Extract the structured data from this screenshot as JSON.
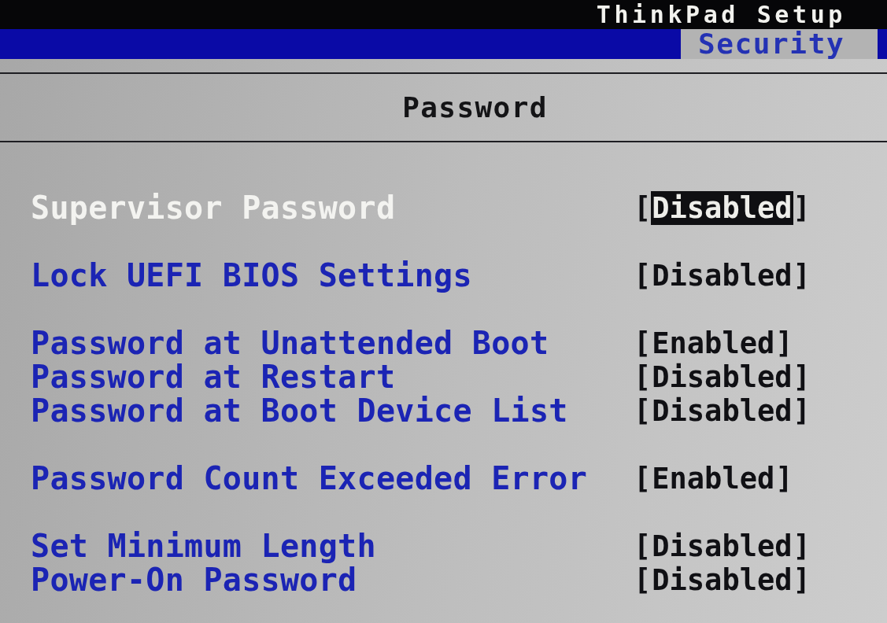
{
  "header": {
    "title": "ThinkPad Setup"
  },
  "tabs": [
    {
      "label": "Security",
      "selected": true
    }
  ],
  "section": {
    "title": "Password"
  },
  "groups": [
    {
      "items": [
        {
          "label": "Supervisor Password",
          "value": "[Disabled]",
          "selected": true
        }
      ]
    },
    {
      "items": [
        {
          "label": "Lock UEFI BIOS Settings",
          "value": "[Disabled]",
          "selected": false
        }
      ]
    },
    {
      "items": [
        {
          "label": "Password at Unattended Boot",
          "value": "[Enabled]",
          "selected": false
        },
        {
          "label": "Password at Restart",
          "value": "[Disabled]",
          "selected": false
        },
        {
          "label": "Password at Boot Device List",
          "value": "[Disabled]",
          "selected": false
        }
      ]
    },
    {
      "items": [
        {
          "label": "Password Count Exceeded Error",
          "value": "[Enabled]",
          "selected": false
        }
      ]
    },
    {
      "items": [
        {
          "label": "Set Minimum Length",
          "value": "[Disabled]",
          "selected": false
        },
        {
          "label": "Power-On Password",
          "value": "[Disabled]",
          "selected": false
        }
      ]
    }
  ]
}
